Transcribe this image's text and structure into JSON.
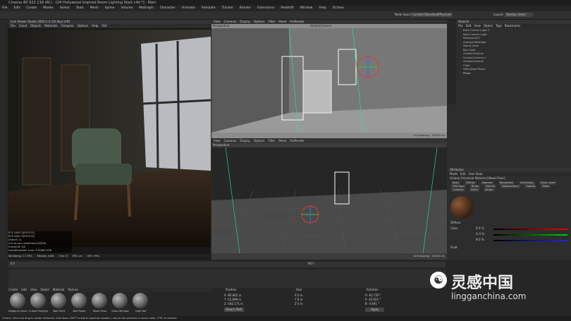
{
  "title": "Cinema 4D S22.118 (RC) - [04 Hollywood Inspired Room Lighting Start.c4d *] - Main",
  "menus": [
    "File",
    "Edit",
    "Create",
    "Modes",
    "Select",
    "Tools",
    "Mesh",
    "Spline",
    "Volume",
    "MoGraph",
    "Character",
    "Animate",
    "Simulate",
    "Tracker",
    "Render",
    "Extensions",
    "Redshift",
    "Window",
    "Help",
    "Octane"
  ],
  "node_space_label": "Node Space:",
  "node_space_value": "Current (Standard/Physical)",
  "layout_label": "Layout:",
  "layout_value": "Startup (User)",
  "live_viewer": {
    "title": "Live Viewer Studio 2020.1.4 (10 days left)",
    "menu": [
      "File",
      "Cloud",
      "Objects",
      "Materials",
      "Compare",
      "Options",
      "Help",
      "GUI"
    ],
    "stats": [
      "RTX 2080 Ti[P2CF23]",
      "RTX 2080 Ti[P2CF23]",
      "DirectX 11",
      "Out-of-core used/max:0/4/5Gb",
      "Grey8/16: 0/0",
      "Used/free/total vram: 6.5GB/6.5GB"
    ],
    "rendering": "Rendering: 1.173%",
    "meshes": "Meshes: 4481",
    "hair": "Hair: 0",
    "rtx": "RTX: on",
    "gpu": "GPU: 99%"
  },
  "viewport_top": {
    "menu": [
      "View",
      "Cameras",
      "Display",
      "Options",
      "Filter",
      "Panel",
      "ProRender"
    ],
    "label": "Perspective",
    "camera": "OctaneCamera",
    "grid": "Grid Spacing : 100.00 cm"
  },
  "viewport_bottom": {
    "menu": [
      "View",
      "Cameras",
      "Display",
      "Options",
      "Filter",
      "Panel",
      "ProRender"
    ],
    "label": "Perspective",
    "grid": "Grid Spacing : 100.00 cm"
  },
  "objects": {
    "header": "Objects",
    "menu": [
      "File",
      "Edit",
      "View",
      "Object",
      "Tags",
      "Bookmarks"
    ],
    "items": [
      "Back Corner Light 1",
      "Back Corner Light",
      "Window ACC",
      "Orange Backlight",
      "Stand_chair",
      "Key Light",
      "OctaneCamera",
      "OctaneCamera.1",
      "OctaneCamera",
      "Chair",
      "Hollywood Room",
      "Plane"
    ]
  },
  "attributes": {
    "header": "Attributes",
    "menu": [
      "Mode",
      "Edit",
      "User Data"
    ],
    "material": "Octane Universal Material [Wood Floor]",
    "tabs": [
      "Basic",
      "Diffuse",
      "Specular",
      "Roughness",
      "Anisotropy",
      "Sheen layer",
      "Film layer",
      "Bump",
      "Normal",
      "Displacement",
      "Opacity",
      "Roles",
      "Common",
      "Editor",
      "Assign"
    ],
    "section": "Diffuse",
    "color_label": "Color",
    "float_label": "Float",
    "r": "R  0 %",
    "g": "G  0 %",
    "b": "B  0 %"
  },
  "timeline": {
    "start": "0 F",
    "end": "90 F",
    "cur": "0 F"
  },
  "materials_menu": [
    "Create",
    "Edit",
    "View",
    "Select",
    "Material",
    "Texture"
  ],
  "materials": [
    "Diagonal Cover",
    "Cutout Foreground",
    "Wall Paint",
    "Wall Paper",
    "Wood Floor",
    "Glass Window",
    "Light Ref"
  ],
  "coords": {
    "position": "Position",
    "size": "Size",
    "rotation": "Rotation",
    "x": "X  -85.802 in",
    "y": "Y  -52.899 in",
    "z": "Z  -182.171 in",
    "sx": "X  0 in",
    "sy": "Y  0 in",
    "sz": "Z  0 in",
    "h": "H  -62.729 °",
    "p": "P  -16.921 °",
    "b": "B  -3.691 °",
    "object": "Object (Rel)",
    "apply": "Apply"
  },
  "status": "Octane: Click and drag to rotate elements. Hold down SHIFT to add to quantize rotation / add to the selection in point mode, CTRL to remove.",
  "watermark": {
    "cn": "灵感中国",
    "url": "lingganchina.com"
  }
}
